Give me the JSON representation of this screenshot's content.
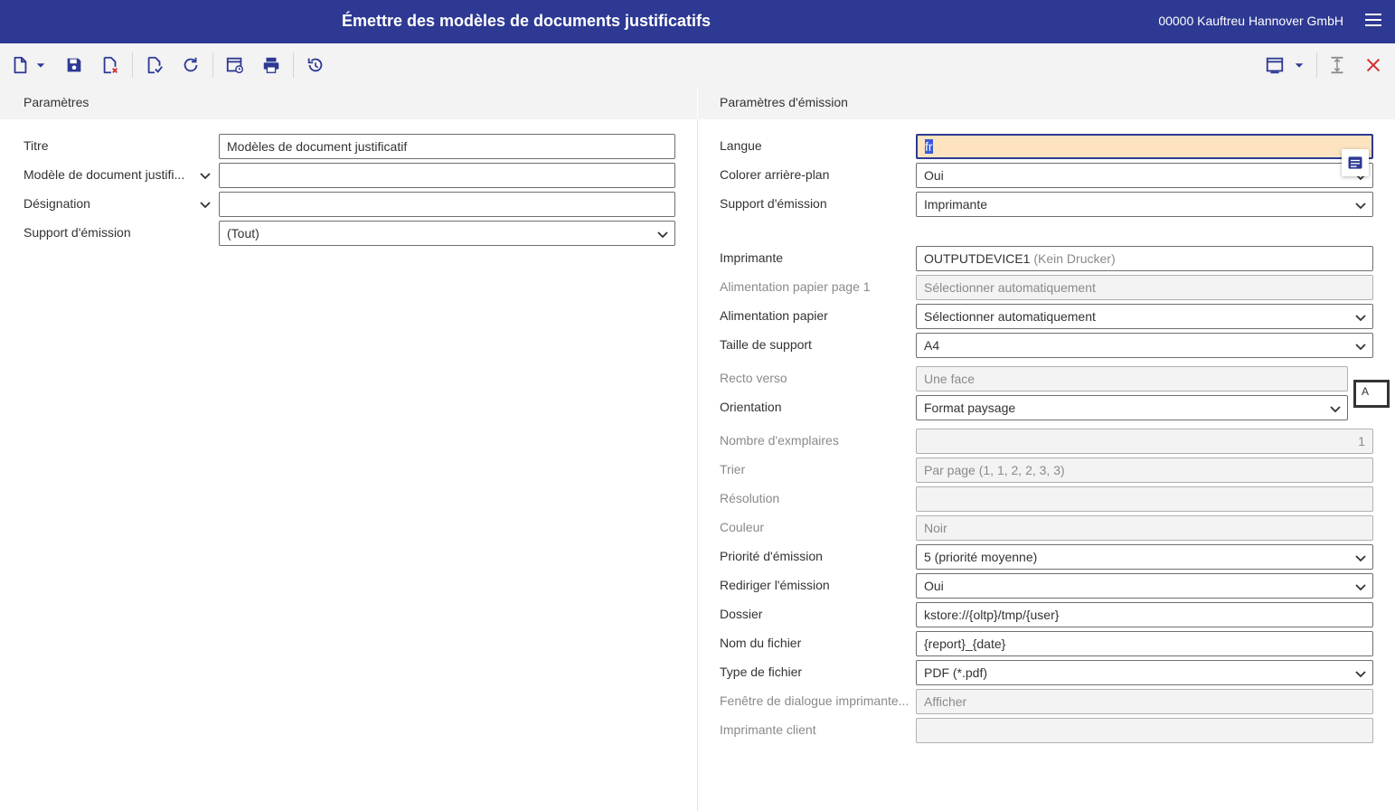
{
  "header": {
    "title": "Émettre des modèles de documents justificatifs",
    "company": "00000  Kauftreu Hannover GmbH"
  },
  "toolbar": {
    "icons": [
      "new-document-icon",
      "dropdown-arrow-icon",
      "save-icon",
      "discard-icon",
      "validate-icon",
      "refresh-icon",
      "schedule-icon",
      "print-icon",
      "restore-icon",
      "window-icon",
      "dropdown-arrow-icon",
      "collapse-icon",
      "close-icon"
    ]
  },
  "left": {
    "section_title": "Paramètres",
    "titre": {
      "label": "Titre",
      "value": "Modèles de document justificatif"
    },
    "modele": {
      "label": "Modèle de document justifi...",
      "value": ""
    },
    "designation": {
      "label": "Désignation",
      "value": ""
    },
    "support": {
      "label": "Support d'émission",
      "value": "(Tout)"
    }
  },
  "right": {
    "section_title": "Paramètres d'émission",
    "langue": {
      "label": "Langue",
      "value": "fr"
    },
    "colorer": {
      "label": "Colorer arrière-plan",
      "value": "Oui"
    },
    "support": {
      "label": "Support d'émission",
      "value": "Imprimante"
    },
    "imprimante": {
      "label": "Imprimante",
      "value": "OUTPUTDEVICE1",
      "hint": "(Kein Drucker)"
    },
    "alim_page1": {
      "label": "Alimentation papier page 1",
      "value": "Sélectionner automatiquement"
    },
    "alim": {
      "label": "Alimentation papier",
      "value": "Sélectionner automatiquement"
    },
    "taille": {
      "label": "Taille de support",
      "value": "A4"
    },
    "recto": {
      "label": "Recto verso",
      "value": "Une face"
    },
    "orientation": {
      "label": "Orientation",
      "value": "Format paysage"
    },
    "nombre": {
      "label": "Nombre d'exmplaires",
      "value": "1"
    },
    "trier": {
      "label": "Trier",
      "value": "Par page (1, 1, 2, 2, 3, 3)"
    },
    "resolution": {
      "label": "Résolution",
      "value": ""
    },
    "couleur": {
      "label": "Couleur",
      "value": "Noir"
    },
    "priorite": {
      "label": "Priorité d'émission",
      "value": "5 (priorité moyenne)"
    },
    "rediriger": {
      "label": "Rediriger l'émission",
      "value": "Oui"
    },
    "dossier": {
      "label": "Dossier",
      "value": "kstore://{oltp}/tmp/{user}"
    },
    "nom": {
      "label": "Nom du fichier",
      "value": "{report}_{date}"
    },
    "type": {
      "label": "Type de fichier",
      "value": "PDF (*.pdf)"
    },
    "fenetre": {
      "label": "Fenêtre de dialogue imprimante...",
      "value": "Afficher"
    },
    "client": {
      "label": "Imprimante client",
      "value": ""
    }
  },
  "popup": {
    "a_label": "A"
  }
}
